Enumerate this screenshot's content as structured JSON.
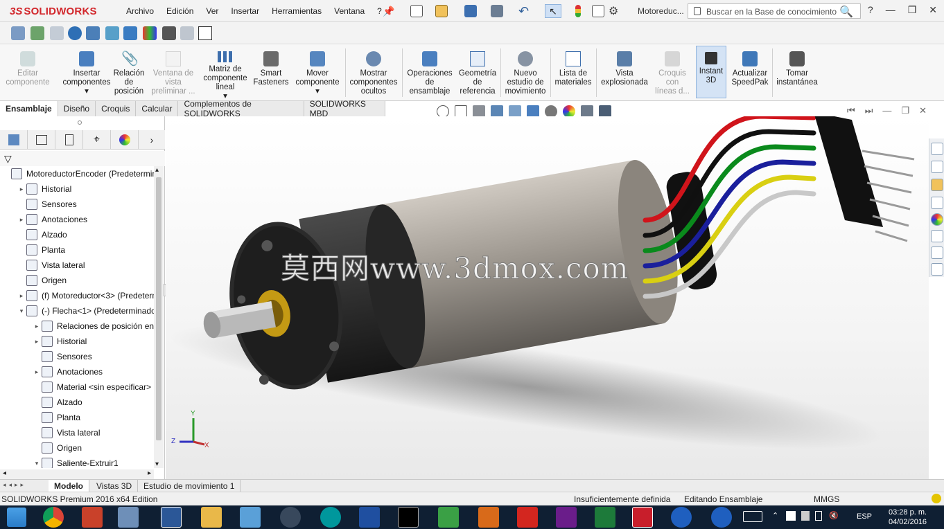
{
  "app": {
    "brand_prefix": "3S",
    "brand": "SOLIDWORKS",
    "doc_name": "Motoreduc..."
  },
  "menu": [
    "Archivo",
    "Edición",
    "Ver",
    "Insertar",
    "Herramientas",
    "Ventana",
    "?"
  ],
  "search": {
    "placeholder": "Buscar en la Base de conocimiento"
  },
  "commands": [
    {
      "label": "Editar\ncomponente",
      "icon": "edit-component-icon",
      "disabled": true
    },
    {
      "label": "Insertar\ncomponentes\n▾",
      "icon": "insert-components-icon",
      "disabled": false
    },
    {
      "label": "Relación\nde\nposición",
      "icon": "mate-icon",
      "disabled": false
    },
    {
      "label": "Ventana de\nvista\npreliminar ...",
      "icon": "preview-window-icon",
      "disabled": true
    },
    {
      "label": "Matriz de\ncomponente\nlineal\n▾",
      "icon": "linear-pattern-icon",
      "disabled": false
    },
    {
      "label": "Smart\nFasteners",
      "icon": "smart-fasteners-icon",
      "disabled": false
    },
    {
      "label": "Mover\ncomponente\n▾",
      "icon": "move-component-icon",
      "disabled": false
    },
    {
      "label": "Mostrar\ncomponentes\nocultos",
      "icon": "show-hidden-icon",
      "disabled": false
    },
    {
      "label": "Operaciones\nde\nensamblaje",
      "icon": "assembly-features-icon",
      "disabled": false
    },
    {
      "label": "Geometría\nde\nreferencia",
      "icon": "reference-geometry-icon",
      "disabled": false
    },
    {
      "label": "Nuevo\nestudio de\nmovimiento",
      "icon": "motion-study-icon",
      "disabled": false
    },
    {
      "label": "Lista de\nmateriales",
      "icon": "bom-icon",
      "disabled": false
    },
    {
      "label": "Vista\nexplosionada",
      "icon": "exploded-view-icon",
      "disabled": false
    },
    {
      "label": "Croquis\ncon\nlíneas d...",
      "icon": "explode-line-sketch-icon",
      "disabled": true
    },
    {
      "label": "Instant\n3D",
      "icon": "instant3d-icon",
      "disabled": false,
      "active": true
    },
    {
      "label": "Actualizar\nSpeedPak",
      "icon": "speedpak-icon",
      "disabled": false
    },
    {
      "label": "Tomar\ninstantánea",
      "icon": "snapshot-icon",
      "disabled": false
    }
  ],
  "cm_tabs": [
    "Ensamblaje",
    "Diseño",
    "Croquis",
    "Calcular",
    "Complementos de SOLIDWORKS",
    "SOLIDWORKS MBD"
  ],
  "tree": [
    {
      "label": "MotoreductorEncoder  (Predetermina",
      "icon": "assembly-icon",
      "exp": "",
      "indent": 0
    },
    {
      "label": "Historial",
      "icon": "history-icon",
      "exp": "▸",
      "indent": 1
    },
    {
      "label": "Sensores",
      "icon": "sensors-icon",
      "exp": "",
      "indent": 1
    },
    {
      "label": "Anotaciones",
      "icon": "annotations-icon",
      "exp": "▸",
      "indent": 1
    },
    {
      "label": "Alzado",
      "icon": "plane-icon",
      "exp": "",
      "indent": 1
    },
    {
      "label": "Planta",
      "icon": "plane-icon",
      "exp": "",
      "indent": 1
    },
    {
      "label": "Vista lateral",
      "icon": "plane-icon",
      "exp": "",
      "indent": 1
    },
    {
      "label": "Origen",
      "icon": "origin-icon",
      "exp": "",
      "indent": 1
    },
    {
      "label": "(f) Motoreductor<3> (Predeterm",
      "icon": "part-icon",
      "exp": "▸",
      "indent": 1
    },
    {
      "label": "(-) Flecha<1> (Predeterminado<",
      "icon": "part-icon",
      "exp": "▾",
      "indent": 1
    },
    {
      "label": "Relaciones de posición en Er",
      "icon": "mates-icon",
      "exp": "▸",
      "indent": 2
    },
    {
      "label": "Historial",
      "icon": "history-icon",
      "exp": "▸",
      "indent": 2
    },
    {
      "label": "Sensores",
      "icon": "sensors-icon",
      "exp": "",
      "indent": 2
    },
    {
      "label": "Anotaciones",
      "icon": "annotations-icon",
      "exp": "▸",
      "indent": 2
    },
    {
      "label": "Material <sin especificar>",
      "icon": "material-icon",
      "exp": "",
      "indent": 2
    },
    {
      "label": "Alzado",
      "icon": "plane-icon",
      "exp": "",
      "indent": 2
    },
    {
      "label": "Planta",
      "icon": "plane-icon",
      "exp": "",
      "indent": 2
    },
    {
      "label": "Vista lateral",
      "icon": "plane-icon",
      "exp": "",
      "indent": 2
    },
    {
      "label": "Origen",
      "icon": "origin-icon",
      "exp": "",
      "indent": 2
    },
    {
      "label": "Saliente-Extruir1",
      "icon": "extrude-icon",
      "exp": "▾",
      "indent": 2
    }
  ],
  "watermark": "莫西网www.3dmox.com",
  "triad": {
    "x": "X",
    "y": "Y",
    "z": "Z"
  },
  "bottom_tabs": [
    "Modelo",
    "Vistas 3D",
    "Estudio de movimiento 1"
  ],
  "status": {
    "edition": "SOLIDWORKS Premium 2016 x64 Edition",
    "definition": "Insuficientemente definida",
    "mode": "Editando Ensamblaje",
    "units": "MMGS"
  },
  "tray": {
    "lang": "ESP",
    "time": "03:28 p. m.",
    "date": "04/02/2016"
  },
  "colors": {
    "brand": "#d2262b",
    "active_cmd": "#d4e3f5",
    "taskbar": "#0f1f33",
    "wires": [
      "#d0141b",
      "#101010",
      "#0a8a1c",
      "#1a1f9c",
      "#d9cf12",
      "#c8c8c8"
    ]
  }
}
